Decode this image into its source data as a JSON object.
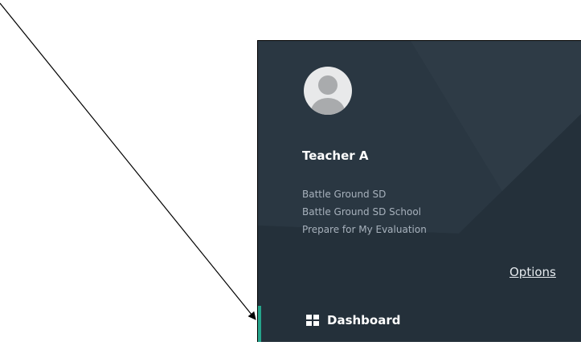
{
  "user": {
    "name": "Teacher A",
    "district": "Battle Ground SD",
    "school": "Battle Ground SD School",
    "task": "Prepare for My Evaluation"
  },
  "options_label": "Options",
  "nav": {
    "items": [
      {
        "label": "Dashboard",
        "icon": "grid-icon",
        "active": true
      }
    ]
  },
  "colors": {
    "panel_bg": "#26323c",
    "accent": "#26a58c",
    "text_primary": "#ffffff",
    "text_secondary": "#a7b1bc"
  }
}
